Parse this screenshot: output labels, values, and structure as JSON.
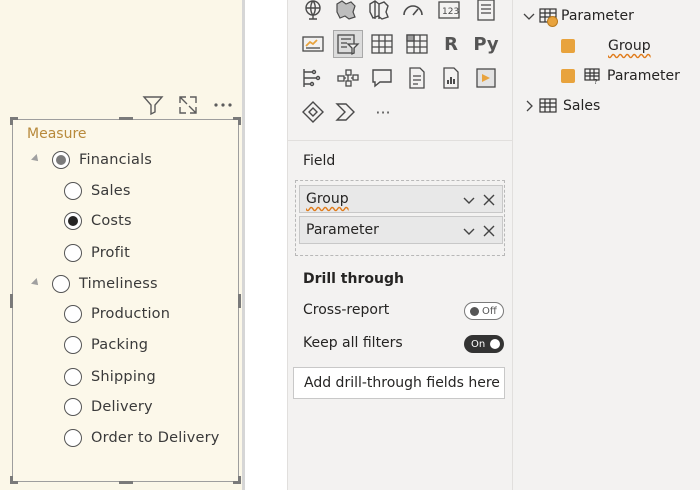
{
  "visual_header": {
    "icons": [
      "filter-icon",
      "focus-mode-icon",
      "more-options-icon"
    ]
  },
  "slicer": {
    "title": "Measure",
    "groups": [
      {
        "label": "Financials",
        "selected": true,
        "items": [
          {
            "label": "Sales",
            "selected": false
          },
          {
            "label": "Costs",
            "selected": true
          },
          {
            "label": "Profit",
            "selected": false
          }
        ]
      },
      {
        "label": "Timeliness",
        "selected": false,
        "items": [
          {
            "label": "Production",
            "selected": false
          },
          {
            "label": "Packing",
            "selected": false
          },
          {
            "label": "Shipping",
            "selected": false
          },
          {
            "label": "Delivery",
            "selected": false
          },
          {
            "label": "Order to Delivery",
            "selected": false
          }
        ]
      }
    ]
  },
  "visualizations": {
    "icons": [
      "globe-map-icon",
      "filled-map-icon",
      "shape-map-icon",
      "gauge-icon",
      "card-icon",
      "multi-row-card-icon",
      "kpi-icon",
      "slicer-icon",
      "table-icon",
      "matrix-icon",
      "r-visual-icon",
      "python-visual-icon",
      "key-influencers-icon",
      "decomposition-tree-icon",
      "qa-icon",
      "smart-narrative-icon",
      "paginated-report-icon",
      "power-apps-icon",
      "power-automate-icon",
      "arcgis-icon",
      "more-visuals-icon"
    ],
    "r_label": "R",
    "py_label": "Py",
    "more_label": "···",
    "field_section_label": "Field",
    "field_pills": [
      {
        "label": "Group"
      },
      {
        "label": "Parameter"
      }
    ],
    "drill_through": {
      "title": "Drill through",
      "cross_report_label": "Cross-report",
      "cross_report_state": "Off",
      "keep_filters_label": "Keep all filters",
      "keep_filters_state": "On",
      "add_fields_text": "Add drill-through fields here"
    }
  },
  "fields_pane": {
    "tables": [
      {
        "name": "Parameter",
        "expanded": true,
        "fields": [
          {
            "name": "Group",
            "checked": true
          },
          {
            "name": "Parameter",
            "checked": true
          }
        ]
      },
      {
        "name": "Sales",
        "expanded": false,
        "fields": []
      }
    ]
  },
  "colors": {
    "canvas_bg": "#fbf7e8",
    "slicer_title": "#b88a3c",
    "pane_bg": "#f3f2f1",
    "accent_orange": "#e8a33d",
    "squiggle": "#e07b1a"
  }
}
